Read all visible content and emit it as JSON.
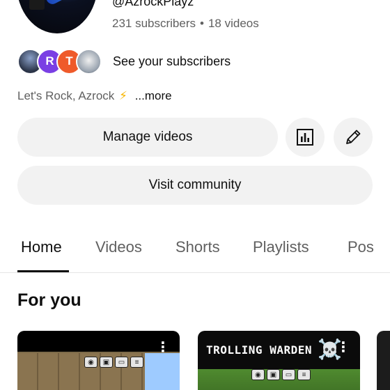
{
  "channel": {
    "handle": "@AzrockPlayz",
    "subscribers": "231 subscribers",
    "separator": "•",
    "videos": "18 videos",
    "subscribers_link": "See your subscribers",
    "subscriber_avatars": [
      "",
      "R",
      "T",
      ""
    ],
    "description": "Let's Rock, Azrock",
    "description_emoji": "⚡",
    "more_label": "...more"
  },
  "actions": {
    "manage_videos": "Manage videos",
    "visit_community": "Visit community",
    "analytics_icon": "bar-chart-icon",
    "edit_icon": "pencil-icon"
  },
  "tabs": [
    {
      "label": "Home",
      "active": true
    },
    {
      "label": "Videos",
      "active": false
    },
    {
      "label": "Shorts",
      "active": false
    },
    {
      "label": "Playlists",
      "active": false
    },
    {
      "label": "Pos",
      "active": false
    }
  ],
  "section": {
    "title": "For you"
  },
  "videos": [
    {
      "overlay_text": "",
      "menu_icon": "more-vert-icon"
    },
    {
      "overlay_text": "TROLLING WARDEN",
      "overlay_emoji": "☠️",
      "menu_icon": "more-vert-icon"
    }
  ],
  "colors": {
    "text_primary": "#0f0f0f",
    "text_secondary": "#606060",
    "button_bg": "#f2f2f2",
    "avatar_r": "#7a3fe4",
    "avatar_t": "#ef5a2a"
  }
}
